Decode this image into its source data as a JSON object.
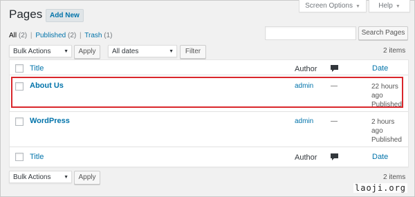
{
  "header": {
    "title": "Pages",
    "add_new": "Add New",
    "screen_options": "Screen Options",
    "help": "Help"
  },
  "views": {
    "all": "All",
    "all_count": "(2)",
    "published": "Published",
    "published_count": "(2)",
    "trash": "Trash",
    "trash_count": "(1)",
    "separator": "|"
  },
  "search": {
    "placeholder": "",
    "button": "Search Pages"
  },
  "tablenav_top": {
    "bulk_actions": "Bulk Actions",
    "apply": "Apply",
    "dates": "All dates",
    "filter": "Filter",
    "items": "2 items"
  },
  "table": {
    "headers": {
      "title": "Title",
      "author": "Author",
      "date": "Date"
    },
    "rows": [
      {
        "title": "About Us",
        "author": "admin",
        "comments": "—",
        "date_line1": "22 hours",
        "date_line2": "ago",
        "status": "Published"
      },
      {
        "title": "WordPress",
        "author": "admin",
        "comments": "—",
        "date_line1": "2 hours",
        "date_line2": "ago",
        "status": "Published"
      }
    ]
  },
  "tablenav_bottom": {
    "bulk_actions": "Bulk Actions",
    "apply": "Apply",
    "items": "2 items"
  },
  "watermark": "laoji.org",
  "colors": {
    "link": "#0073aa",
    "highlight_border": "#d9262b",
    "background": "#f1f1f1"
  },
  "icons": {
    "comment": "speech-bubble-icon",
    "dropdown": "triangle-down-icon"
  }
}
